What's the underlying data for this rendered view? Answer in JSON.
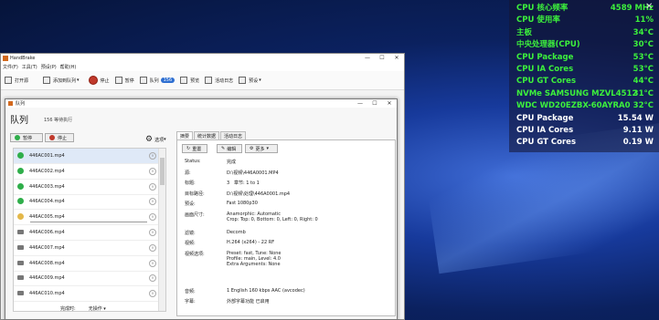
{
  "osd": {
    "rows": [
      {
        "label": "CPU 核心频率",
        "value": "4589 MHz",
        "color": "#3cf03c"
      },
      {
        "label": "CPU 使用率",
        "value": "11%",
        "color": "#3cf03c"
      },
      {
        "label": "主板",
        "value": "34°C",
        "color": "#3cf03c"
      },
      {
        "label": "中央处理器(CPU)",
        "value": "30°C",
        "color": "#3cf03c"
      },
      {
        "label": "CPU Package",
        "value": "53°C",
        "color": "#3cf03c"
      },
      {
        "label": "CPU IA Cores",
        "value": "53°C",
        "color": "#3cf03c"
      },
      {
        "label": "CPU GT Cores",
        "value": "44°C",
        "color": "#3cf03c"
      },
      {
        "label": "NVMe SAMSUNG MZVL4512",
        "value": "31°C",
        "color": "#3cf03c"
      },
      {
        "label": "WDC WD20EZBX-60AYRA0",
        "value": "32°C",
        "color": "#3cf03c"
      },
      {
        "label": "CPU Package",
        "value": "15.54 W",
        "color": "#ffffff"
      },
      {
        "label": "CPU IA Cores",
        "value": "9.11 W",
        "color": "#ffffff"
      },
      {
        "label": "CPU GT Cores",
        "value": "0.19 W",
        "color": "#ffffff"
      }
    ]
  },
  "main": {
    "title": "HandBrake",
    "menu": [
      "文件(F)",
      "工具(T)",
      "预设(P)",
      "帮助(H)"
    ],
    "toolbar": {
      "open": "打开源",
      "add_queue": "添加到队列",
      "stop": "停止",
      "pause": "暂停",
      "queue": "队列",
      "queue_badge": "156",
      "preview": "预览",
      "activity": "活动日志",
      "presets": "预设"
    }
  },
  "queue": {
    "title": "队列",
    "heading": "队列",
    "subtitle": "156 等待执行",
    "pause_btn": "暂停",
    "stop_btn": "停止",
    "options_btn": "选项",
    "items": [
      {
        "name": "446AC001.mp4",
        "status": "done"
      },
      {
        "name": "446AC002.mp4",
        "status": "done"
      },
      {
        "name": "446AC003.mp4",
        "status": "done"
      },
      {
        "name": "446AC004.mp4",
        "status": "done"
      },
      {
        "name": "446AC005.mp4",
        "status": "run"
      },
      {
        "name": "446AC006.mp4",
        "status": "wait"
      },
      {
        "name": "446AC007.mp4",
        "status": "wait"
      },
      {
        "name": "446AC008.mp4",
        "status": "wait"
      },
      {
        "name": "446AC009.mp4",
        "status": "wait"
      },
      {
        "name": "446AC010.mp4",
        "status": "wait"
      }
    ],
    "footer_left": "完成时:",
    "footer_right": "无操作",
    "tabs": [
      "摘要",
      "统计数据",
      "活动日志"
    ],
    "actions": {
      "reset": "重置",
      "edit": "编辑",
      "more": "更多"
    },
    "details": [
      {
        "k": "Status:",
        "v": "完成"
      },
      {
        "k": "源:",
        "v": "D:\\视频\\446A0001.MP4"
      },
      {
        "k": "标题:",
        "v": "3   章节: 1 to 1"
      },
      {
        "k": "目标路径:",
        "v": "D:\\视频\\处理\\446A0001.mp4"
      },
      {
        "k": "预设:",
        "v": "Fast 1080p30"
      },
      {
        "k": "画面尺寸:",
        "v": "Anamorphic: Automatic\nCrop: Top: 0, Bottom: 0, Left: 0, Right: 0"
      },
      {
        "k": "滤镜:",
        "v": "Decomb"
      },
      {
        "k": "视频:",
        "v": "H.264 (x264) - 22 RF"
      },
      {
        "k": "视频选项:",
        "v": "Preset: fast, Tune: None\nProfile: main, Level: 4.0\nExtra Arguments: None"
      },
      {
        "k": "音频:",
        "v": "1 English 160 kbps AAC (avcodec)"
      },
      {
        "k": "字幕:",
        "v": "外部字幕功能 已启用"
      }
    ]
  }
}
